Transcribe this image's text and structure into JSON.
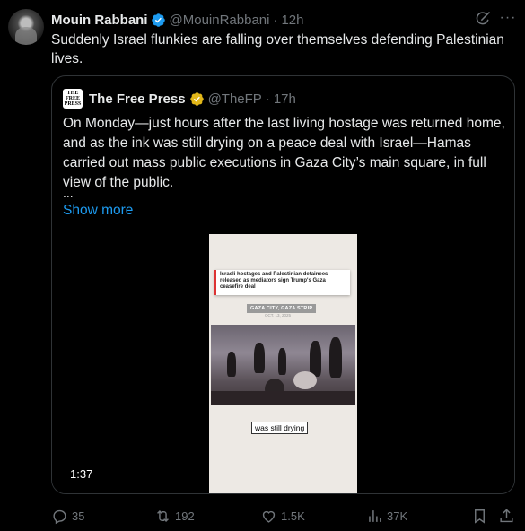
{
  "author": {
    "name": "Mouin Rabbani",
    "handle": "@MouinRabbani",
    "time": "12h"
  },
  "tweet_text": "Suddenly Israel flunkies are falling over themselves defending Palestinian lives.",
  "quote": {
    "logo_text": "THE FREE PRESS",
    "name": "The Free Press",
    "handle": "@TheFP",
    "time": "17h",
    "text": "On Monday—just hours after the last living hostage was returned home, and as the ink was still drying on a peace deal with Israel—Hamas carried out mass public executions in Gaza City’s main square, in full view of the public.",
    "ellipsis": "...",
    "show_more": "Show more",
    "video": {
      "duration": "1:37",
      "headline": "Israeli hostages and Palestinian detainees released as mediators sign Trump's Gaza ceasefire deal",
      "location": "GAZA CITY, GAZA STRIP",
      "date": "OCT. 13, 2025",
      "caption": "was still drying"
    }
  },
  "actions": {
    "replies": "35",
    "reposts": "192",
    "likes": "1.5K",
    "views": "37K"
  },
  "colors": {
    "background": "#000000",
    "text": "#e7e9ea",
    "muted": "#71767b",
    "link": "#1d9bf0",
    "verified_blue": "#1d9bf0",
    "verified_gold": "#e2b719",
    "border": "#2f3336"
  },
  "icons": [
    "verified-badge-icon",
    "gold-verified-badge-icon",
    "grok-icon",
    "more-icon",
    "reply-icon",
    "repost-icon",
    "like-icon",
    "views-icon",
    "bookmark-icon",
    "share-icon"
  ]
}
